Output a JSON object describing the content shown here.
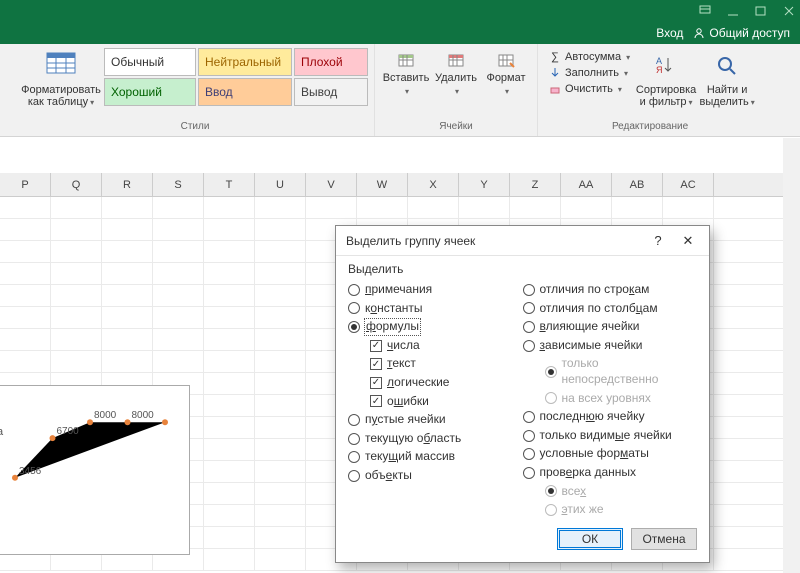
{
  "titlebar": {
    "login": "Вход",
    "share": "Общий доступ"
  },
  "ribbon": {
    "format_table": {
      "line1": "Форматировать",
      "line2": "как таблицу"
    },
    "styles_label": "Стили",
    "styles": {
      "normal": "Обычный",
      "neutral": "Нейтральный",
      "bad": "Плохой",
      "good": "Хороший",
      "input": "Ввод",
      "output": "Вывод"
    },
    "cells_label": "Ячейки",
    "insert": "Вставить",
    "delete": "Удалить",
    "format": "Формат",
    "edit_label": "Редактирование",
    "autosum": "Автосумма",
    "fill": "Заполнить",
    "clear": "Очистить",
    "sort": {
      "line1": "Сортировка",
      "line2": "и фильтр"
    },
    "find": {
      "line1": "Найти и",
      "line2": "выделить"
    }
  },
  "columns": [
    "P",
    "Q",
    "R",
    "S",
    "T",
    "U",
    "V",
    "W",
    "X",
    "Y",
    "Z",
    "AA",
    "AB",
    "AC"
  ],
  "chart_data": {
    "type": "line",
    "x": [
      1,
      2,
      3,
      4,
      5
    ],
    "values": [
      3456,
      6700,
      8000,
      8000,
      8000
    ],
    "labels": [
      "3456",
      "6700",
      "8000",
      "8000",
      ""
    ],
    "ylim": [
      0,
      9000
    ]
  },
  "chart_legend_a": "а",
  "dialog": {
    "title": "Выделить группу ячеек",
    "help": "?",
    "fs": "Выделить",
    "left": {
      "comments": "примечания",
      "constants": "константы",
      "formulas": "формулы",
      "numbers": "числа",
      "text": "текст",
      "logical": "логические",
      "errors": "ошибки",
      "empty": "пустые ячейки",
      "region": "текущую область",
      "array": "текущий массив",
      "objects": "объекты"
    },
    "right": {
      "rowdiff": "отличия по строкам",
      "coldiff": "отличия по столбцам",
      "precedents": "влияющие ячейки",
      "dependents": "зависимые ячейки",
      "direct": "только непосредственно",
      "alllevels": "на всех уровнях",
      "last": "последнюю ячейку",
      "visible": "только видимые ячейки",
      "condfmt": "условные форматы",
      "datavalid": "проверка данных",
      "all": "всех",
      "same": "этих же"
    },
    "ok": "ОК",
    "cancel": "Отмена"
  }
}
